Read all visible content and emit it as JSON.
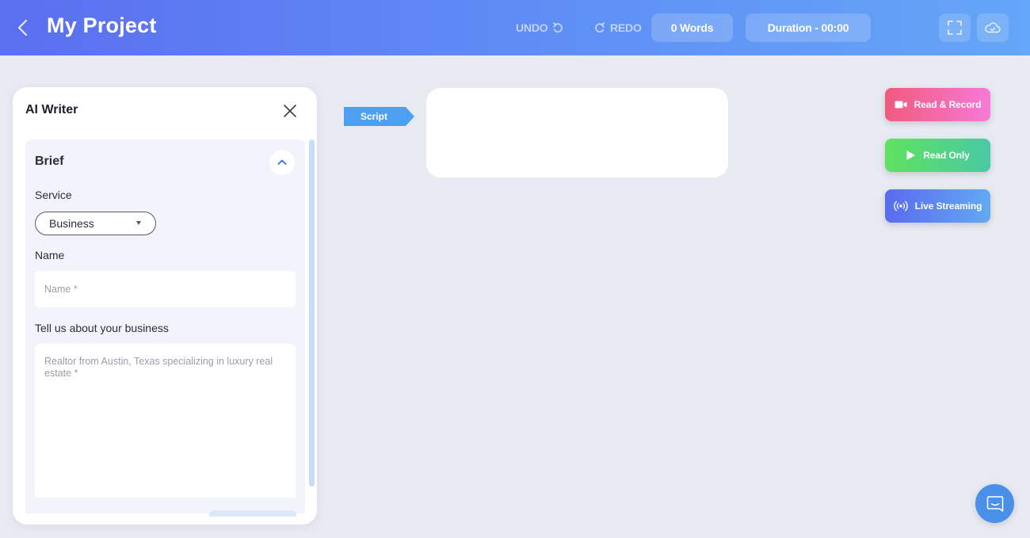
{
  "header": {
    "title": "My Project",
    "undo_label": "UNDO",
    "redo_label": "REDO",
    "words": "0 Words",
    "duration": "Duration - 00:00",
    "icons": [
      "chevron-left-icon",
      "undo-icon",
      "redo-icon",
      "fullscreen-icon",
      "cloud-icon"
    ]
  },
  "panel": {
    "title": "AI Writer",
    "brief": {
      "title": "Brief",
      "service_label": "Service",
      "service_value": "Business",
      "name_label": "Name",
      "name_placeholder": "Name *",
      "about_label": "Tell us about your business",
      "about_placeholder": "Realtor from Austin, Texas specializing in luxury real estate *"
    }
  },
  "script": {
    "tag_label": "Script",
    "content": ""
  },
  "actions": {
    "read_record": "Read & Record",
    "read_only": "Read Only",
    "live_streaming": "Live Streaming"
  },
  "colors": {
    "header_start": "#5b6ff0",
    "header_end": "#64a6f7",
    "script_tag": "#4d9ff0",
    "record_start": "#f15a7d",
    "record_end": "#f67ad6",
    "read_start": "#5fe25f",
    "read_end": "#49c9a4",
    "live_start": "#5a6bef",
    "live_end": "#62a9f2",
    "chat": "#4a8fe8"
  }
}
